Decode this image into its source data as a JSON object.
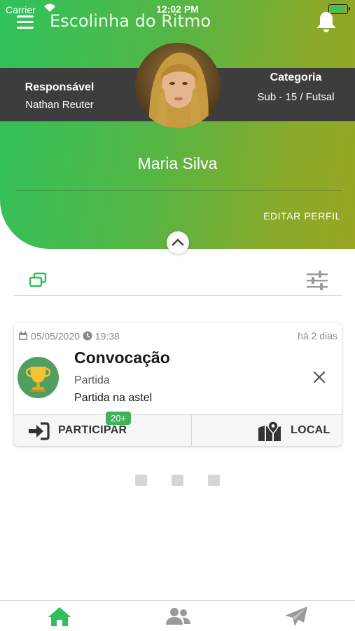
{
  "status_bar": {
    "carrier": "Carrier",
    "time": "12:02 PM"
  },
  "header": {
    "title": "Escolinha do Ritmo",
    "responsavel_label": "Responsável",
    "responsavel_name": "Nathan Reuter",
    "categoria_label": "Categoria",
    "categoria_value": "Sub - 15 / Futsal",
    "user_name": "Maria Silva",
    "edit_profile": "EDITAR PERFIL"
  },
  "card": {
    "date": "05/05/2020",
    "time": "19:38",
    "ago": "há 2 dias",
    "title": "Convocação",
    "type": "Partida",
    "description": "Partida na astel",
    "participate_label": "PARTICIPAR",
    "participants_badge": "20+",
    "local_label": "LOCAL"
  },
  "colors": {
    "gradient_start": "#2fc25c",
    "gradient_end": "#98a623",
    "band": "#3d3d3d",
    "accent": "#3fb35b"
  },
  "icons": [
    "menu-icon",
    "bell-icon",
    "chevron-up-icon",
    "cards-icon",
    "filter-sliders-icon",
    "calendar-icon",
    "clock-icon",
    "trophy-icon",
    "close-icon",
    "sign-in-icon",
    "map-pin-icon",
    "home-icon",
    "users-icon",
    "send-icon"
  ]
}
